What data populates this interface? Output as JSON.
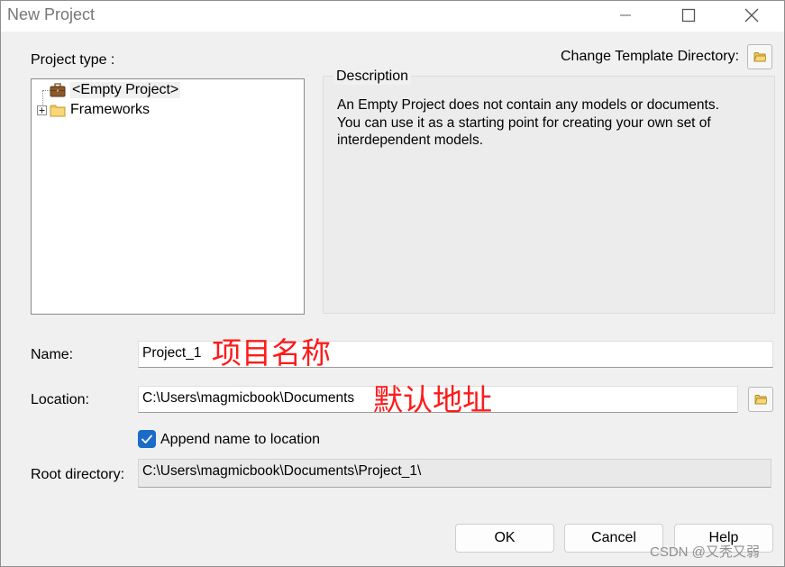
{
  "window": {
    "title": "New Project",
    "controls": [
      "minimize-icon",
      "maximize-icon",
      "close-icon"
    ]
  },
  "project_type": {
    "label": "Project type :",
    "items": [
      {
        "label": "<Empty Project>",
        "icon": "briefcase-icon",
        "selected": true
      },
      {
        "label": "Frameworks",
        "icon": "folder-icon",
        "expander": "plus-icon"
      }
    ]
  },
  "template": {
    "label": "Change Template Directory:",
    "icon": "folder-open-icon"
  },
  "description": {
    "legend": "Description",
    "lines": [
      "An Empty Project does not contain any models or documents.",
      "You can use it as a starting point for creating your own set of",
      "interdependent models."
    ]
  },
  "form": {
    "name_label": "Name:",
    "name_value": "Project_1",
    "location_label": "Location:",
    "location_value": "C:\\Users\\magmicbook\\Documents",
    "append_label": "Append name to location",
    "append_checked": true,
    "root_label": "Root directory:",
    "root_value": "C:\\Users\\magmicbook\\Documents\\Project_1\\"
  },
  "annotations": {
    "name_note": "项目名称",
    "location_note": "默认地址"
  },
  "buttons": {
    "ok": "OK",
    "cancel": "Cancel",
    "help": "Help"
  },
  "watermark": "CSDN @又秃又弱",
  "colors": {
    "dialog_bg": "#f0f0f0",
    "annotation": "#ff1a1a",
    "checkbox": "#1a6cc7"
  }
}
